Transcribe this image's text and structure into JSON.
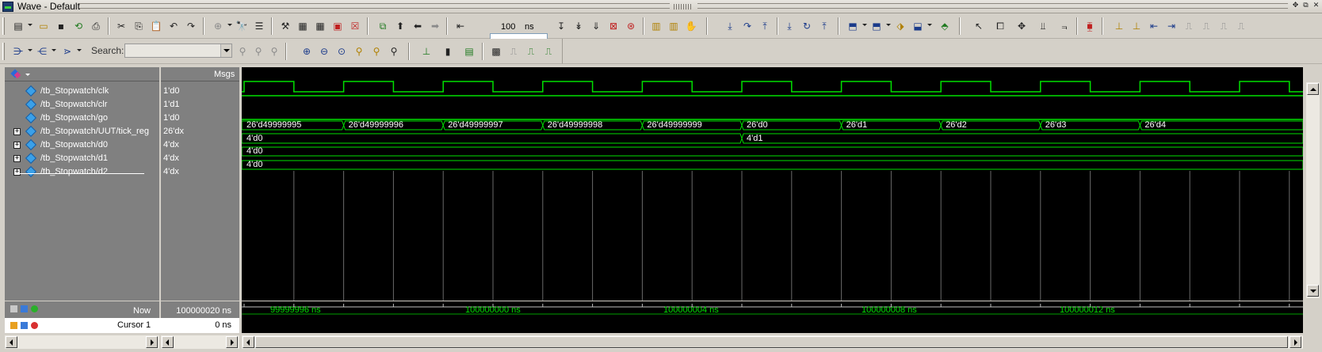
{
  "window": {
    "title": "Wave - Default"
  },
  "toolbar": {
    "zoom_step_value": "100",
    "zoom_step_unit": "ns",
    "search_label": "Search:",
    "search_value": ""
  },
  "wave": {
    "column_header_msgs": "Msgs",
    "signals": [
      {
        "name": "/tb_Stopwatch/clk",
        "value": "1'd0",
        "expandable": false
      },
      {
        "name": "/tb_Stopwatch/clr",
        "value": "1'd1",
        "expandable": false
      },
      {
        "name": "/tb_Stopwatch/go",
        "value": "1'd0",
        "expandable": false
      },
      {
        "name": "/tb_Stopwatch/UUT/tick_reg",
        "value": "26'dx",
        "expandable": true
      },
      {
        "name": "/tb_Stopwatch/d0",
        "value": "4'dx",
        "expandable": true
      },
      {
        "name": "/tb_Stopwatch/d1",
        "value": "4'dx",
        "expandable": true
      },
      {
        "name": "/tb_Stopwatch/d2",
        "value": "4'dx",
        "expandable": true
      }
    ],
    "tick_reg_labels": [
      "26'd49999995",
      "26'd49999996",
      "26'd49999997",
      "26'd49999998",
      "26'd49999999",
      "26'd0",
      "26'd1",
      "26'd2",
      "26'd3",
      "26'd4"
    ],
    "d0_labels": [
      "4'd0",
      "4'd1"
    ],
    "d1_labels": [
      "4'd0"
    ],
    "d2_labels": [
      "4'd0"
    ],
    "now_label": "Now",
    "now_value": "100000020 ns",
    "cursor_label": "Cursor 1",
    "cursor_value": "0 ns",
    "timeline_labels": [
      "99999996 ns",
      "100000000 ns",
      "100000004 ns",
      "100000008 ns",
      "100000012 ns"
    ]
  },
  "colors": {
    "wave_green": "#00e000",
    "wave_bg": "#000000",
    "panel_grey": "#808080"
  }
}
